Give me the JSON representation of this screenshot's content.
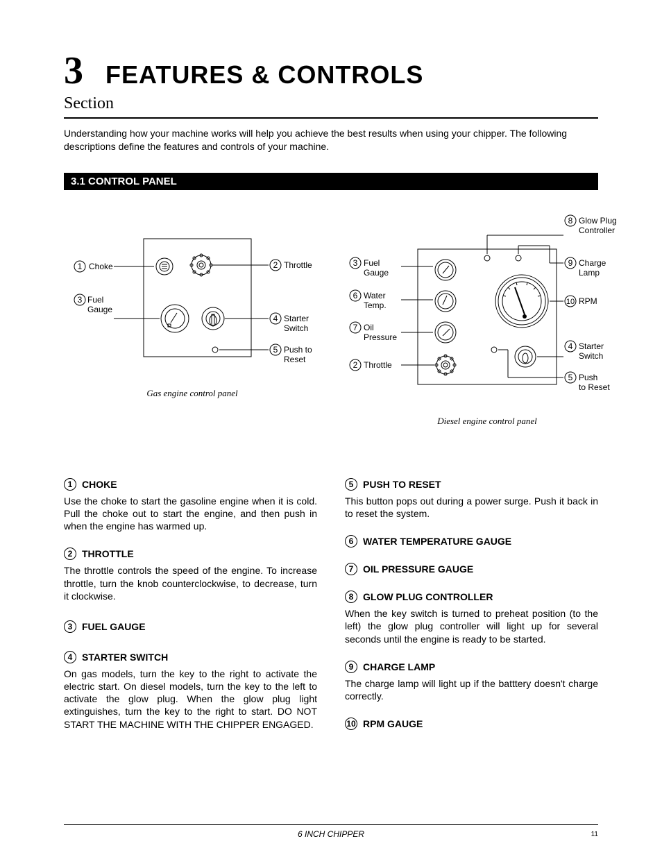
{
  "chapter": {
    "number": "3",
    "title": "FEATURES & CONTROLS",
    "section_label": "Section"
  },
  "intro": "Understanding how your machine works will help you achieve the best results when using your chipper.  The following descriptions define the features and controls of your machine.",
  "section_bar": "3.1 CONTROL PANEL",
  "fig_gas": {
    "caption": "Gas engine control panel",
    "labels": {
      "choke": "Choke",
      "throttle": "Throttle",
      "fuel_gauge_a": "Fuel",
      "fuel_gauge_b": "Gauge",
      "starter_a": "Starter",
      "starter_b": "Switch",
      "reset_a": "Push to",
      "reset_b": "Reset"
    }
  },
  "fig_diesel": {
    "caption": "Diesel engine control panel",
    "labels": {
      "glow_a": "Glow Plug",
      "glow_b": "Controller",
      "charge_a": "Charge",
      "charge_b": "Lamp",
      "rpm": "RPM",
      "starter_a": "Starter",
      "starter_b": "Switch",
      "push_a": "Push",
      "push_b": "to Reset",
      "fuel_a": "Fuel",
      "fuel_b": "Gauge",
      "water_a": "Water",
      "water_b": "Temp.",
      "oil_a": "Oil",
      "oil_b": "Pressure",
      "throttle": "Throttle"
    }
  },
  "items": {
    "choke": {
      "num": "1",
      "title": "CHOKE",
      "body": "Use the choke to start the gasoline engine when it is cold. Pull the choke out to start the engine, and then push in when the engine has warmed up."
    },
    "throttle": {
      "num": "2",
      "title": "THROTTLE",
      "body": "The throttle controls the speed of the engine. To increase throttle, turn the knob counterclockwise, to decrease, turn it clockwise."
    },
    "fuel": {
      "num": "3",
      "title": "FUEL GAUGE"
    },
    "starter": {
      "num": "4",
      "title": "STARTER SWITCH",
      "body": "On gas models, turn the key to the right to activate the electric start. On diesel models, turn the key to the left to activate the glow plug. When the glow plug light extinguishes, turn the key to the right to start. DO NOT START THE MACHINE WITH THE CHIPPER ENGAGED."
    },
    "reset": {
      "num": "5",
      "title": "PUSH TO RESET",
      "body": "This button pops out during a power surge. Push it back in to reset the system."
    },
    "water": {
      "num": "6",
      "title": "WATER TEMPERATURE GAUGE"
    },
    "oil": {
      "num": "7",
      "title": "OIL PRESSURE GAUGE"
    },
    "glow": {
      "num": "8",
      "title": "GLOW PLUG CONTROLLER",
      "body": "When the key switch is turned to preheat position (to the left) the glow plug controller will light up for several seconds until the engine is ready to be started."
    },
    "charge": {
      "num": "9",
      "title": "CHARGE LAMP",
      "body": "The charge lamp will light up if the batttery doesn't charge correctly."
    },
    "rpm": {
      "num": "10",
      "title": "RPM GAUGE"
    }
  },
  "footer": {
    "title": "6 INCH CHIPPER",
    "page": "11"
  }
}
